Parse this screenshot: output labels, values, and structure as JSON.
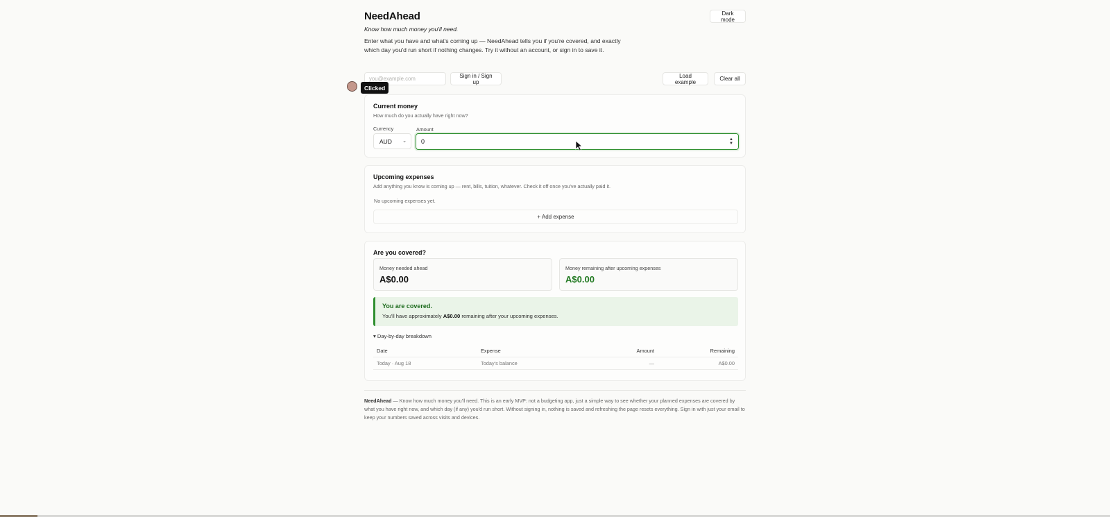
{
  "header": {
    "title": "NeedAhead",
    "tagline": "Know how much money you'll need.",
    "intro": "Enter what you have and what's coming up — NeedAhead tells you if you're covered, and exactly which day you'd run short if nothing changes. Try it without an account, or sign in to save it.",
    "dark_mode_label": "Dark mode"
  },
  "auth": {
    "email_placeholder": "you@example.com",
    "signin_label": "Sign in / Sign up",
    "load_example_label": "Load example",
    "clear_all_label": "Clear all"
  },
  "click_indicator": {
    "label": "Clicked"
  },
  "current_money": {
    "title": "Current money",
    "subtitle": "How much do you actually have right now?",
    "currency_label": "Currency",
    "currency_value": "AUD",
    "amount_label": "Amount",
    "amount_value": "0"
  },
  "expenses": {
    "title": "Upcoming expenses",
    "subtitle": "Add anything you know is coming up — rent, bills, tuition, whatever. Check it off once you've actually paid it.",
    "empty_text": "No upcoming expenses yet.",
    "add_label": "+ Add expense"
  },
  "covered": {
    "title": "Are you covered?",
    "needed_label": "Money needed ahead",
    "needed_value": "A$0.00",
    "remaining_label": "Money remaining after upcoming expenses",
    "remaining_value": "A$0.00",
    "banner_title": "You are covered.",
    "banner_prefix": "You'll have approximately ",
    "banner_amount": "A$0.00",
    "banner_suffix": " remaining after your upcoming expenses.",
    "breakdown_label": "▾ Day-by-day breakdown",
    "table": {
      "headers": [
        "Date",
        "Expense",
        "Amount",
        "Remaining"
      ],
      "rows": [
        [
          "Today · Aug 18",
          "Today's balance",
          "—",
          "A$0.00"
        ]
      ]
    }
  },
  "footer": {
    "brand": "NeedAhead",
    "text": " — Know how much money you'll need. This is an early MVP: not a budgeting app, just a simple way to see whether your planned expenses are covered by what you have right now, and which day (if any) you'd run short. Without signing in, nothing is saved and refreshing the page resets everything. Sign in with just your email to keep your numbers saved across visits and devices."
  },
  "colors": {
    "accent_green": "#2f8f2f",
    "banner_bg": "#eaf4e8"
  }
}
